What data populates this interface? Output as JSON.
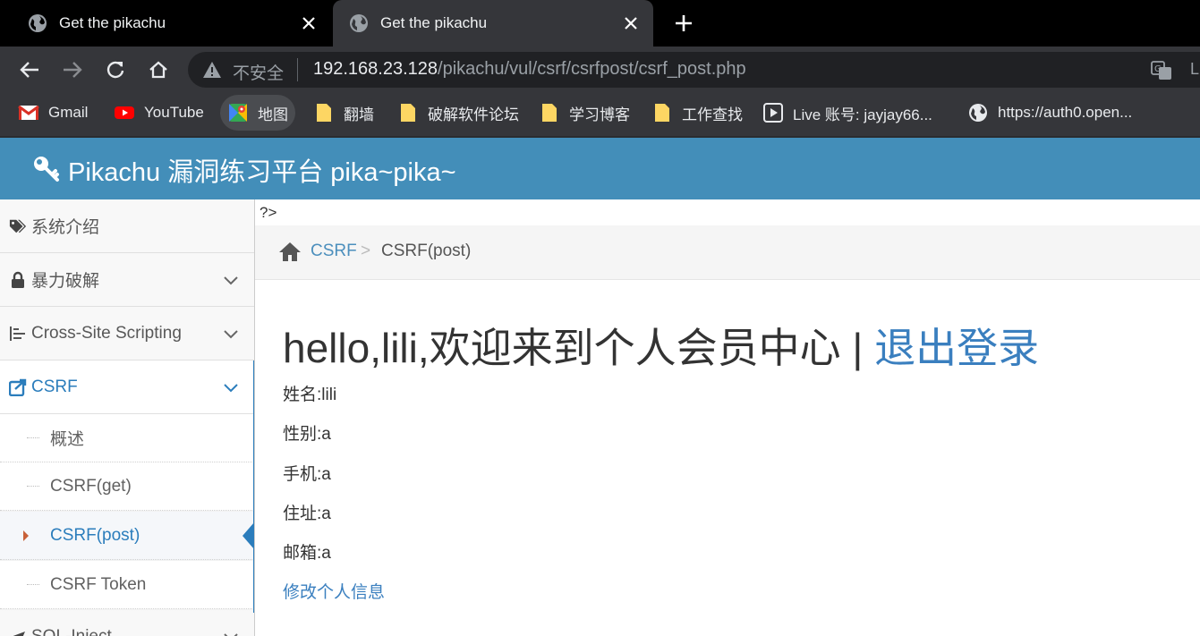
{
  "browser": {
    "tabs": [
      {
        "title": "Get the pikachu",
        "icon": "globe-icon",
        "active": false
      },
      {
        "title": "Get the pikachu",
        "icon": "globe-icon",
        "active": true
      }
    ],
    "insecure_label": "不安全",
    "url_host": "192.168.23.128",
    "url_path": "/pikachu/vul/csrf/csrfpost/csrf_post.php",
    "bookmarks": [
      {
        "label": "Gmail",
        "icon": "gmail-icon"
      },
      {
        "label": "YouTube",
        "icon": "youtube-icon"
      },
      {
        "label": "地图",
        "icon": "maps-icon"
      },
      {
        "label": "翻墙",
        "icon": "folder-icon"
      },
      {
        "label": "破解软件论坛",
        "icon": "folder-icon"
      },
      {
        "label": "学习博客",
        "icon": "folder-icon"
      },
      {
        "label": "工作查找",
        "icon": "folder-icon"
      },
      {
        "label": "Live 账号: jayjay66...",
        "icon": "live-icon"
      },
      {
        "label": "https://auth0.open...",
        "icon": "globe-icon"
      }
    ]
  },
  "header": {
    "brand": "Pikachu 漏洞练习平台 pika~pika~"
  },
  "sidebar": {
    "items": [
      {
        "label": "系统介绍",
        "icon": "tags-icon"
      },
      {
        "label": "暴力破解",
        "icon": "lock-icon"
      },
      {
        "label": "Cross-Site Scripting",
        "icon": "list-icon"
      },
      {
        "label": "CSRF",
        "icon": "share-icon"
      },
      {
        "label": "SQL-Inject",
        "icon": "plane-icon"
      }
    ],
    "sub_items": [
      {
        "label": "概述"
      },
      {
        "label": "CSRF(get)"
      },
      {
        "label": "CSRF(post)"
      },
      {
        "label": "CSRF Token"
      }
    ]
  },
  "main": {
    "stray_text": "?>",
    "breadcrumb": {
      "link": "CSRF",
      "separator": ">",
      "current": "CSRF(post)"
    },
    "welcome": "hello,lili,欢迎来到个人会员中心",
    "pipe": "|",
    "logout": "退出登录",
    "fields": [
      "姓名:lili",
      "性别:a",
      "手机:a",
      "住址:a",
      "邮箱:a"
    ],
    "edit_link": "修改个人信息"
  },
  "colors": {
    "header": "#438eb9",
    "accent": "#2b7dbc",
    "tab_active": "#35363a"
  }
}
